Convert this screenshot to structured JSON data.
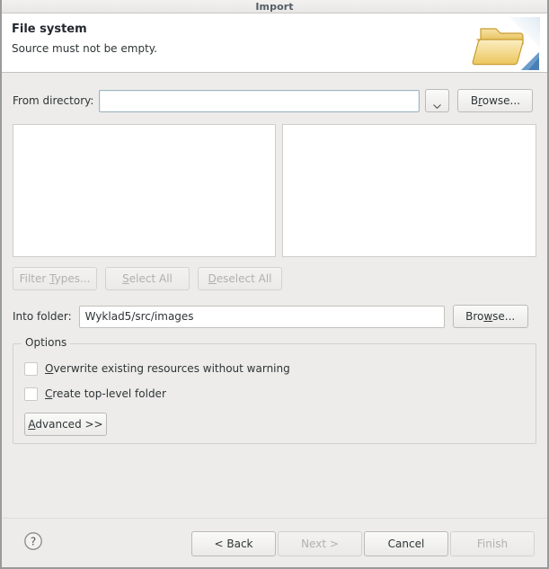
{
  "window": {
    "title": "Import"
  },
  "header": {
    "title": "File system",
    "message": "Source must not be empty.",
    "icon": "open-folder-import-icon"
  },
  "from_directory": {
    "label": "From directory:",
    "value": "",
    "placeholder": "",
    "dropdown_icon": "chevron-down-icon",
    "browse_label": "Browse...",
    "browse_mnemonic": "r"
  },
  "panes": {
    "left": {
      "items": []
    },
    "right": {
      "items": []
    }
  },
  "selection_buttons": [
    {
      "label": "Filter Types...",
      "mnemonic": "T",
      "enabled": false
    },
    {
      "label": "Select All",
      "mnemonic": "S",
      "enabled": false
    },
    {
      "label": "Deselect All",
      "mnemonic": "D",
      "enabled": false
    }
  ],
  "into_folder": {
    "label": "Into folder:",
    "value": "Wyklad5/src/images",
    "browse_label": "Browse...",
    "browse_mnemonic": "w"
  },
  "options": {
    "group_label": "Options",
    "checkboxes": [
      {
        "label": "Overwrite existing resources without warning",
        "mnemonic": "O",
        "checked": false
      },
      {
        "label": "Create top-level folder",
        "mnemonic": "C",
        "checked": false
      }
    ],
    "advanced_label": "Advanced >>",
    "advanced_mnemonic": "A"
  },
  "footer": {
    "help_icon": "question-mark-circle-icon",
    "buttons": [
      {
        "label": "< Back",
        "enabled": true
      },
      {
        "label": "Next >",
        "enabled": false
      },
      {
        "label": "Cancel",
        "enabled": true
      },
      {
        "label": "Finish",
        "enabled": false
      }
    ]
  },
  "colors": {
    "dialog_background": "#edecea",
    "header_background": "#ffffff",
    "text": "#2e3436",
    "disabled_text": "#b2b0ad",
    "field_border": "#c2c0bd",
    "focus_border": "#9fb3c0",
    "folder_icon": "#f0cd72",
    "folder_icon_dark": "#d9ae3f",
    "arrow_blue": "#4a7fb5"
  }
}
